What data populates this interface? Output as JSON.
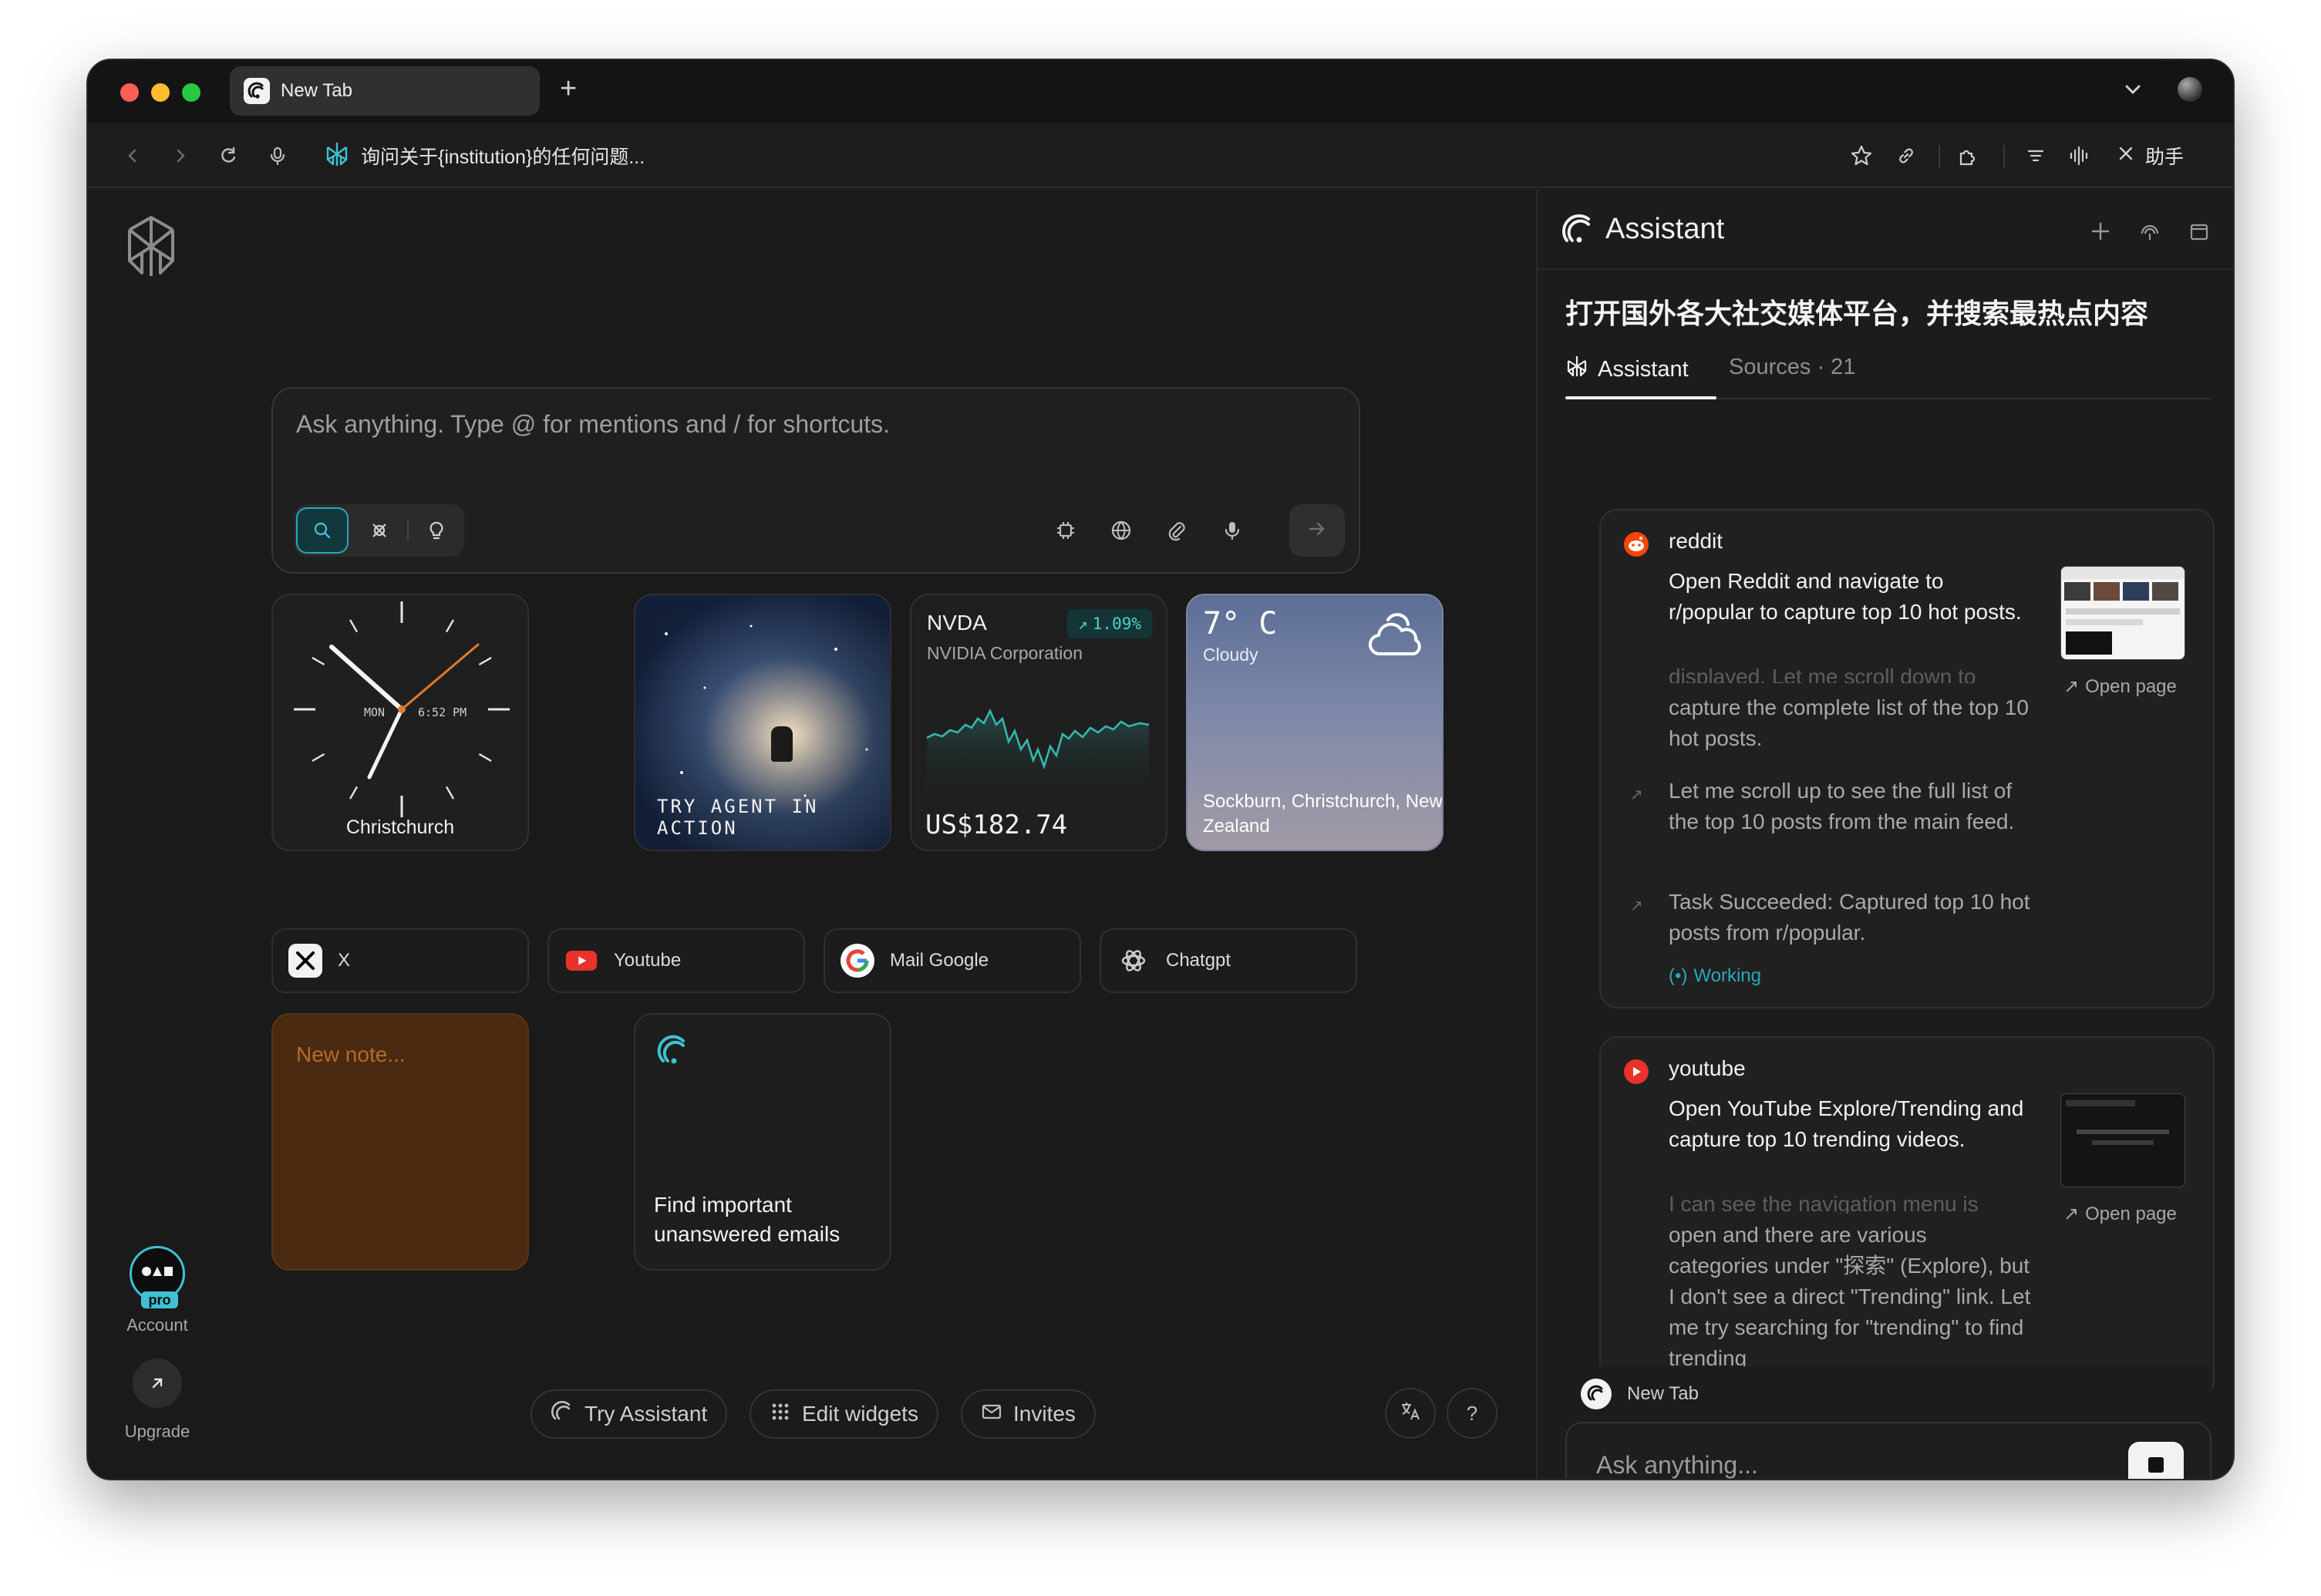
{
  "browser": {
    "tab_title": "New Tab",
    "new_tab_symbol": "+",
    "address_text": "询问关于{institution}的任何问题...",
    "assistant_toggle_label": "助手",
    "colors": {
      "close": "#ff5f57",
      "minimize": "#febc2e",
      "zoom": "#28c840"
    }
  },
  "search": {
    "placeholder": "Ask anything. Type @ for mentions and / for shortcuts."
  },
  "widgets": {
    "clock": {
      "day": "MON",
      "time": "6:52 PM",
      "city": "Christchurch"
    },
    "agent": {
      "caption": "TRY AGENT IN ACTION"
    },
    "stock": {
      "ticker": "NVDA",
      "name": "NVIDIA Corporation",
      "change": "1.09%",
      "price": "US$182.74"
    },
    "weather": {
      "temp": "7° C",
      "condition": "Cloudy",
      "location": "Sockburn, Christchurch, New Zealand"
    }
  },
  "shortcuts": [
    {
      "label": "X",
      "icon": "x-logo-icon"
    },
    {
      "label": "Youtube",
      "icon": "youtube-icon"
    },
    {
      "label": "Mail Google",
      "icon": "google-icon"
    },
    {
      "label": "Chatgpt",
      "icon": "chatgpt-icon"
    }
  ],
  "note": {
    "placeholder": "New note..."
  },
  "tip": {
    "text": "Find important unanswered emails"
  },
  "footer": {
    "try_assistant": "Try Assistant",
    "edit_widgets": "Edit widgets",
    "invites": "Invites",
    "help": "?"
  },
  "rail": {
    "account_label": "Account",
    "pro_badge": "pro",
    "upgrade_label": "Upgrade"
  },
  "assistant": {
    "title": "Assistant",
    "question": "打开国外各大社交媒体平台，并搜索最热点内容",
    "tabs": {
      "assistant": "Assistant",
      "sources": "Sources · 21"
    },
    "cards": [
      {
        "source": "reddit",
        "task": "Open Reddit and navigate to r/popular to capture top 10 hot posts.",
        "open_page": "Open page",
        "faded_step": "displayed. Let me scroll down to",
        "steps": [
          "capture the complete list of the top 10 hot posts.",
          "Let me scroll up to see the full list of the top 10 posts from the main feed.",
          "Task Succeeded: Captured top 10 hot posts from r/popular."
        ],
        "status": "Working"
      },
      {
        "source": "youtube",
        "task": "Open YouTube Explore/Trending and capture top 10 trending videos.",
        "open_page": "Open page",
        "faded_step": "I can see the navigation menu is",
        "steps": [
          "open and there are various categories under \"探索\" (Explore), but I don't see a direct \"Trending\" link. Let me try searching for \"trending\" to find trending"
        ]
      }
    ],
    "context_tab": "New Tab",
    "ask_placeholder": "Ask anything..."
  },
  "accent": {
    "teal": "#2aa7b8",
    "stock_green": "#4fd1c5",
    "clock_second_hand": "#e07a2e"
  }
}
